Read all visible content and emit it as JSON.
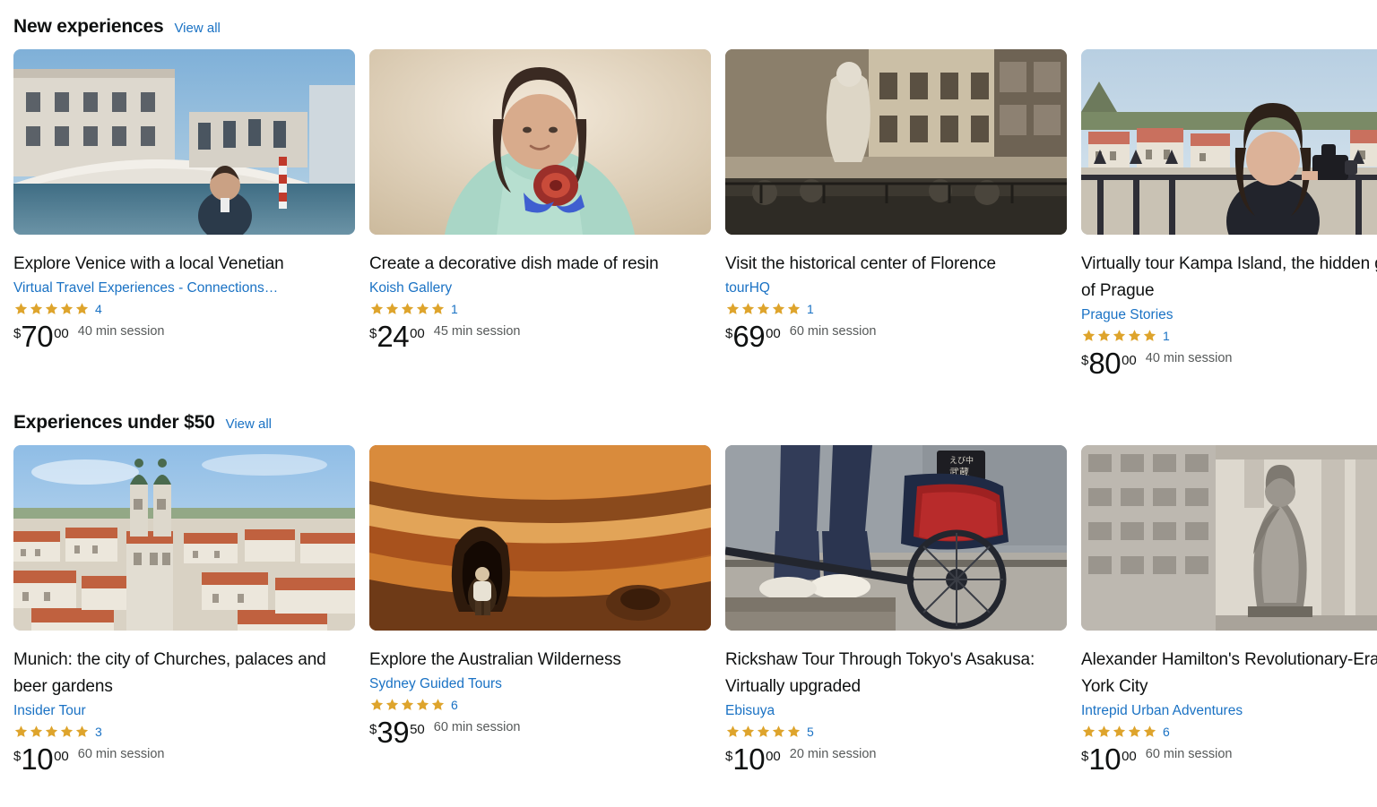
{
  "sections": [
    {
      "title": "New experiences",
      "view_all_label": "View all",
      "cards": [
        {
          "title": "Explore Venice with a local Venetian",
          "provider": "Virtual Travel Experiences - Connections…",
          "stars": 5,
          "rating_count": "4",
          "price_symbol": "$",
          "price_whole": "70",
          "price_frac": "00",
          "duration": "40 min session",
          "image_alt": "Man standing in front of Rialto Bridge over Venice canal",
          "image_palette": [
            "#8fb8d8",
            "#e8e4dc",
            "#b9ccd6",
            "#2c3d52"
          ]
        },
        {
          "title": "Create a decorative dish made of resin",
          "provider": "Koish Gallery",
          "stars": 5,
          "rating_count": "1",
          "price_symbol": "$",
          "price_whole": "24",
          "price_frac": "00",
          "duration": "45 min session",
          "image_alt": "Woman in mint sweater holding a red resin dish",
          "image_palette": [
            "#d8c4a4",
            "#f0e4d2",
            "#a8d4c4",
            "#8a2b2b"
          ]
        },
        {
          "title": "Visit the historical center of Florence",
          "provider": "tourHQ",
          "stars": 5,
          "rating_count": "1",
          "price_symbol": "$",
          "price_whole": "69",
          "price_frac": "00",
          "duration": "60 min session",
          "image_alt": "Neptune fountain and statue in Piazza della Signoria, Florence",
          "image_palette": [
            "#8a7a66",
            "#cfc3ae",
            "#6b6256",
            "#3a3630"
          ]
        },
        {
          "title": "Virtually tour Kampa Island, the hidden gem of Prague",
          "provider": "Prague Stories",
          "stars": 5,
          "rating_count": "1",
          "price_symbol": "$",
          "price_whole": "80",
          "price_frac": "00",
          "duration": "40 min session",
          "image_alt": "Woman with camera on Charles Bridge overlooking Prague rooftops",
          "image_palette": [
            "#bcd2e4",
            "#c9705e",
            "#e5dfd4",
            "#2b2b33"
          ]
        }
      ]
    },
    {
      "title": "Experiences under $50",
      "view_all_label": "View all",
      "cards": [
        {
          "title": "Munich: the city of Churches, palaces and beer gardens",
          "provider": "Insider Tour",
          "stars": 5,
          "rating_count": "3",
          "price_symbol": "$",
          "price_whole": "10",
          "price_frac": "00",
          "duration": "60 min session",
          "image_alt": "Aerial view of Munich rooftops with Frauenkirche towers",
          "image_palette": [
            "#9dc6e8",
            "#c96b50",
            "#d9d2c4",
            "#6a7a5e"
          ]
        },
        {
          "title": "Explore the Australian Wilderness",
          "provider": "Sydney Guided Tours",
          "stars": 5,
          "rating_count": "6",
          "price_symbol": "$",
          "price_whole": "39",
          "price_frac": "50",
          "duration": "60 min session",
          "image_alt": "Person crouching inside striped orange sandstone cave",
          "image_palette": [
            "#c4702a",
            "#e0a558",
            "#6b4526",
            "#f0c88c"
          ]
        },
        {
          "title": "Rickshaw Tour Through Tokyo's Asakusa: Virtually upgraded",
          "provider": "Ebisuya",
          "stars": 5,
          "rating_count": "5",
          "price_symbol": "$",
          "price_whole": "10",
          "price_frac": "00",
          "duration": "20 min session",
          "image_alt": "Rickshaw puller legs and wheel with red seat in Tokyo",
          "image_palette": [
            "#9aa0a6",
            "#b22222",
            "#1f2a44",
            "#d8d2c8"
          ]
        },
        {
          "title": "Alexander Hamilton's Revolutionary-Era New York City",
          "provider": "Intrepid Urban Adventures",
          "stars": 5,
          "rating_count": "6",
          "price_symbol": "$",
          "price_whole": "10",
          "price_frac": "00",
          "duration": "60 min session",
          "image_alt": "Statue of George Washington in front of Federal Hall columns",
          "image_palette": [
            "#c9c4bc",
            "#8d8880",
            "#e4e0d8",
            "#55504a"
          ]
        }
      ]
    }
  ],
  "colors": {
    "link": "#1a72c4",
    "star": "#DEA42C",
    "text": "#0F1111",
    "muted": "#565959",
    "background": "#FFFFFF"
  }
}
